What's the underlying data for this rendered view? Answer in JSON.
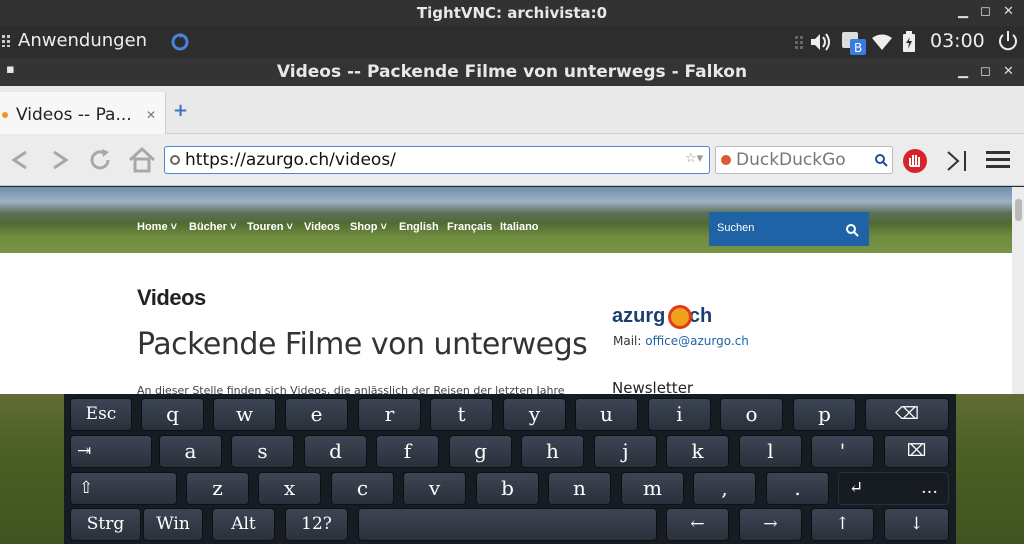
{
  "vnc": {
    "title": "TightVNC: archivista:0",
    "min": "▁",
    "max": "◻",
    "close": "✕"
  },
  "panel": {
    "apps_label": "Anwendungen",
    "clock": "03:00"
  },
  "falkon": {
    "title": "Videos -- Packende Filme von unterwegs - Falkon"
  },
  "tabs": [
    {
      "label": "Videos -- Pa...",
      "close": "✕"
    }
  ],
  "new_tab": "+",
  "nav": {
    "url": "https://azurgo.ch/videos/",
    "search_placeholder": "DuckDuckGo"
  },
  "site": {
    "nav": [
      "Home",
      "Bücher",
      "Touren",
      "Videos",
      "Shop",
      "English",
      "Français",
      "Italiano"
    ],
    "search_label": "Suchen",
    "h1": "Videos",
    "h2": "Packende Filme von unterwegs",
    "intro": "An dieser Stelle finden sich Videos, die anlässlich der Reisen der letzten Jahre",
    "logo_left": "azurg",
    "logo_right": ".ch",
    "mail_label": "Mail: ",
    "mail_link": "office@azurgo.ch",
    "newsletter": "Newsletter"
  },
  "keyboard": {
    "row1": [
      "Esc",
      "q",
      "w",
      "e",
      "r",
      "t",
      "y",
      "u",
      "i",
      "o",
      "p",
      "⌫"
    ],
    "row2": [
      "⇥",
      "a",
      "s",
      "d",
      "f",
      "g",
      "h",
      "j",
      "k",
      "l",
      "'",
      "⌧"
    ],
    "row3": [
      "⇧",
      "z",
      "x",
      "c",
      "v",
      "b",
      "n",
      "m",
      ",",
      ".",
      "↵",
      "…"
    ],
    "row4": [
      "Strg",
      "Win",
      "Alt",
      "12?",
      "",
      "←",
      "→",
      "↑",
      "↓"
    ]
  },
  "colors": {
    "accent": "#1f63a6",
    "url_border": "#4d87d2"
  }
}
